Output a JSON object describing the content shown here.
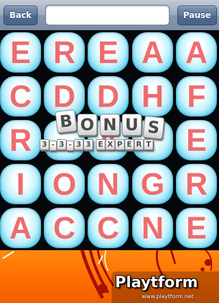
{
  "toolbar": {
    "back_label": "Back",
    "pause_label": "Pause",
    "word_field_value": ""
  },
  "board": {
    "rows": [
      [
        "E",
        "R",
        "E",
        "A",
        "A"
      ],
      [
        "C",
        "D",
        "D",
        "H",
        "F"
      ],
      [
        "R",
        "",
        "A",
        "",
        "E"
      ],
      [
        "I",
        "O",
        "N",
        "G",
        "R"
      ],
      [
        "A",
        "C",
        "C",
        "N",
        "E"
      ]
    ]
  },
  "bonus": {
    "word": [
      "B",
      "O",
      "N",
      "U",
      "S"
    ],
    "combo": [
      "3",
      "-",
      "3",
      "-",
      "3",
      "3",
      "E",
      "X",
      "P",
      "E",
      "R",
      "T"
    ]
  },
  "watermark": {
    "logo_text": "Playtform",
    "url": "www.playtform.net"
  },
  "colors": {
    "letter": "#ef6c6e",
    "tile": "#61d3ef",
    "panel": "#ff6d00"
  }
}
